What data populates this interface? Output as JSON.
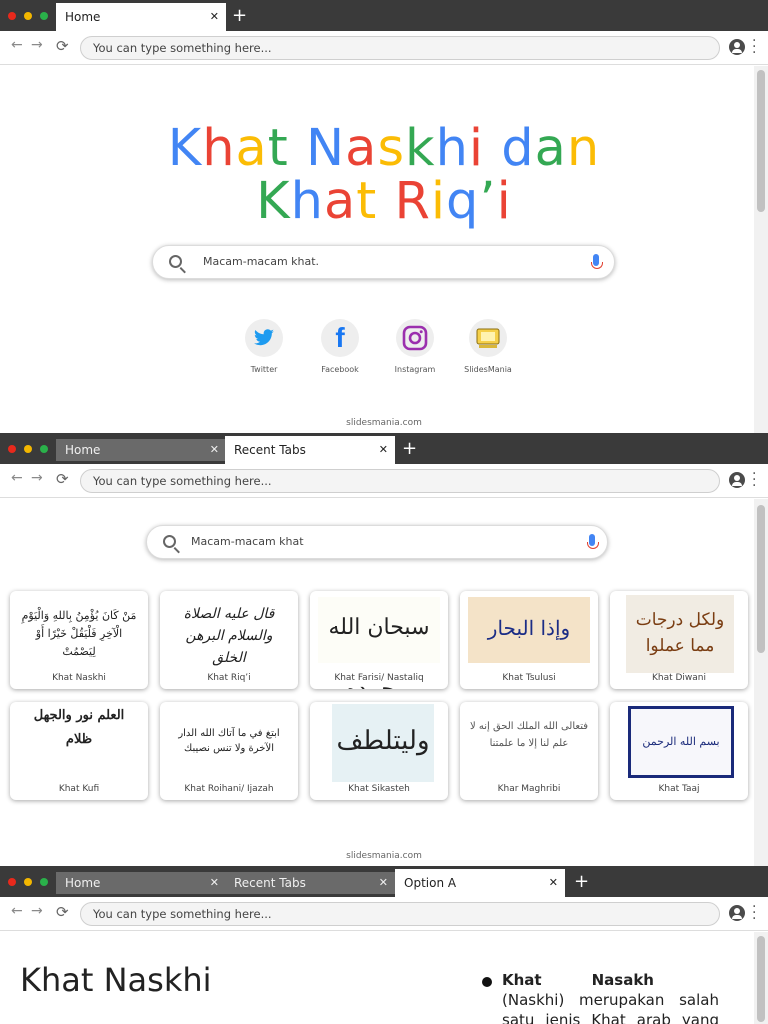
{
  "browser": {
    "address_placeholder": "You can type something here..."
  },
  "slide1": {
    "tabs": [
      {
        "label": "Home",
        "close": "✕"
      }
    ],
    "title_line1": [
      "K",
      "h",
      "a",
      "t",
      " ",
      "N",
      "a",
      "s",
      "k",
      "h",
      "i",
      " ",
      "d",
      "a",
      "n"
    ],
    "title_line2": [
      "K",
      "h",
      "a",
      "t",
      " ",
      "R",
      "i",
      "q",
      "’",
      "i"
    ],
    "search_text": "Macam-macam khat.",
    "social": [
      {
        "label": "Twitter",
        "icon": "twitter-icon"
      },
      {
        "label": "Facebook",
        "icon": "facebook-icon"
      },
      {
        "label": "Instagram",
        "icon": "instagram-icon"
      },
      {
        "label": "SlidesMania",
        "icon": "slidesmania-icon"
      }
    ],
    "footer": "slidesmania.com"
  },
  "slide2": {
    "tabs": [
      {
        "label": "Home",
        "close": "✕"
      },
      {
        "label": "Recent Tabs",
        "close": "✕"
      }
    ],
    "search_text": "Macam-macam khat",
    "cards": [
      {
        "label": "Khat Naskhi",
        "art": "مَنْ كَانَ يُؤْمِنُ بِاللهِ وَالْيَوْمِ الْآخِرِ فَلْيَقُلْ خَيْرًا أَوْ لِيَصْمُتْ"
      },
      {
        "label": "Khat Riq’i",
        "art": "قال عليه الصلاة والسلام البرهن الخلق"
      },
      {
        "label": "Khat Farisi/ Nastaliq",
        "art": "سبحان الله وبحمده"
      },
      {
        "label": "Khat Tsulusi",
        "art": "وإذا البحار سجرت"
      },
      {
        "label": "Khat Diwani",
        "art": "ولكل درجات مما عملوا"
      },
      {
        "label": "Khat Kufi",
        "art": "العلم نور والجهل ظلام"
      },
      {
        "label": "Khat Roihani/ Ijazah",
        "art": "ابتغ في ما آتاك الله الدار الآخرة ولا تنس نصيبك"
      },
      {
        "label": "Khat Sikasteh",
        "art": "وليتلطف"
      },
      {
        "label": "Khar Maghribi",
        "art": "فتعالى الله الملك الحق إنه لا علم لنا إلا ما علمتنا"
      },
      {
        "label": "Khat Taaj",
        "art": "بسم الله الرحمن الرحيم"
      }
    ],
    "footer": "slidesmania.com"
  },
  "slide3": {
    "tabs": [
      {
        "label": "Home",
        "close": "✕"
      },
      {
        "label": "Recent Tabs",
        "close": "✕"
      },
      {
        "label": "Option A",
        "close": "✕"
      }
    ],
    "heading": "Khat Naskhi",
    "para_bold1": "Khat",
    "para_bold2": "Nasakh",
    "para_rest": " (Naskhi) merupakan salah satu jenis Khat arab yang paling mudah"
  },
  "colors": {
    "blue": "#4285f4",
    "red": "#ea4335",
    "yellow": "#fbbc05",
    "green": "#34a853"
  }
}
